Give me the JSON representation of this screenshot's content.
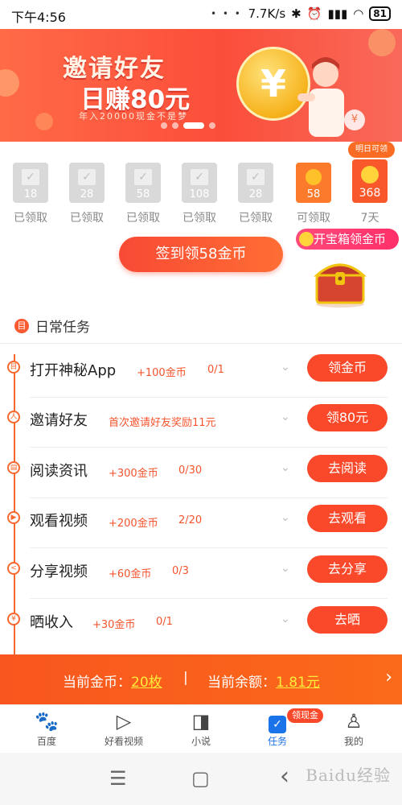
{
  "status_bar": {
    "time": "下午4:56",
    "dots": "• • •",
    "net_speed": "7.7K/s",
    "battery": "81"
  },
  "banner": {
    "title": "邀请好友",
    "subtitle": "日赚80元",
    "note": "年入20000现金不是梦",
    "coin_symbol": "¥",
    "mini_coin": "¥"
  },
  "checkin": {
    "days": [
      {
        "value": "18",
        "label": "已领取",
        "state": "claimed"
      },
      {
        "value": "28",
        "label": "已领取",
        "state": "claimed"
      },
      {
        "value": "58",
        "label": "已领取",
        "state": "claimed"
      },
      {
        "value": "108",
        "label": "已领取",
        "state": "claimed"
      },
      {
        "value": "28",
        "label": "已领取",
        "state": "claimed"
      },
      {
        "value": "58",
        "label": "可领取",
        "state": "available"
      },
      {
        "value": "368",
        "label": "7天",
        "state": "future"
      }
    ],
    "tomorrow_tag": "明日可领",
    "sign_button": "签到领58金币",
    "chest_tag": "开宝箱领金币"
  },
  "daily": {
    "title": "日常任务",
    "icon": "目",
    "tasks": [
      {
        "name": "打开神秘App",
        "reward": "+100金币",
        "progress": "0/1",
        "button": "领金币",
        "icon": "目"
      },
      {
        "name": "邀请好友",
        "reward": "首次邀请好友奖励11元",
        "progress": "",
        "button": "领80元",
        "icon": "人"
      },
      {
        "name": "阅读资讯",
        "reward": "+300金币",
        "progress": "0/30",
        "button": "去阅读",
        "icon": "▤"
      },
      {
        "name": "观看视频",
        "reward": "+200金币",
        "progress": "2/20",
        "button": "去观看",
        "icon": "▶"
      },
      {
        "name": "分享视频",
        "reward": "+60金币",
        "progress": "0/3",
        "button": "去分享",
        "icon": "<"
      },
      {
        "name": "晒收入",
        "reward": "+30金币",
        "progress": "0/1",
        "button": "去晒",
        "icon": "¥"
      }
    ]
  },
  "balance": {
    "coins_label": "当前金币：",
    "coins_value": "20枚",
    "separator": "|",
    "cash_label": "当前余额：",
    "cash_value": "1.81元",
    "arrow": "›"
  },
  "tabs": [
    {
      "label": "百度",
      "icon": "🐾"
    },
    {
      "label": "好看视频",
      "icon": "▷"
    },
    {
      "label": "小说",
      "icon": "◨"
    },
    {
      "label": "任务",
      "icon": "✓"
    },
    {
      "label": "我的",
      "icon": "♙"
    }
  ],
  "tab_badge": "领现金",
  "nav": {
    "menu": "☰",
    "home": "▢",
    "back": "‹"
  },
  "watermark": "Baidu经验",
  "colors": {
    "accent": "#f9492a",
    "active_tab": "#1a73e8",
    "gold": "#ffeb3b"
  }
}
